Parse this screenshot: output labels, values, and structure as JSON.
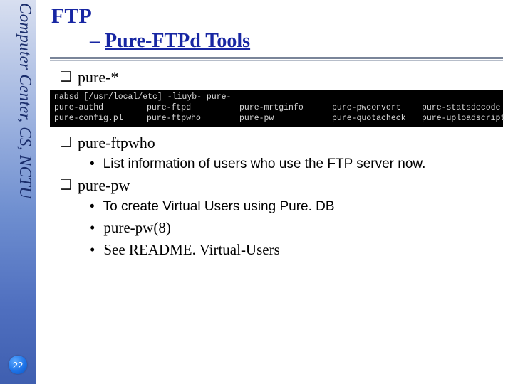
{
  "sidebar": {
    "label": "Computer Center, CS, NCTU",
    "page_number": "22"
  },
  "header": {
    "title": "FTP",
    "subtitle_prefix": "– ",
    "subtitle": "Pure-FTPd Tools"
  },
  "sections": {
    "s1": {
      "heading": "pure-*"
    },
    "s2": {
      "heading": "pure-ftpwho",
      "items": {
        "i1": "List information of users who use the FTP server now."
      }
    },
    "s3": {
      "heading": "pure-pw",
      "items": {
        "i1": "To create Virtual Users using Pure. DB",
        "i2": "pure-pw(8)",
        "i3": "See README. Virtual-Users"
      }
    }
  },
  "terminal": {
    "prompt": "nabsd [/usr/local/etc] -liuyb- pure-",
    "rows": {
      "r1": {
        "c1": "pure-authd",
        "c2": "pure-ftpd",
        "c3": "pure-mrtginfo",
        "c4": "pure-pwconvert",
        "c5": "pure-statsdecode"
      },
      "r2": {
        "c1": "pure-config.pl",
        "c2": "pure-ftpwho",
        "c3": "pure-pw",
        "c4": "pure-quotacheck",
        "c5": "pure-uploadscript"
      }
    }
  }
}
